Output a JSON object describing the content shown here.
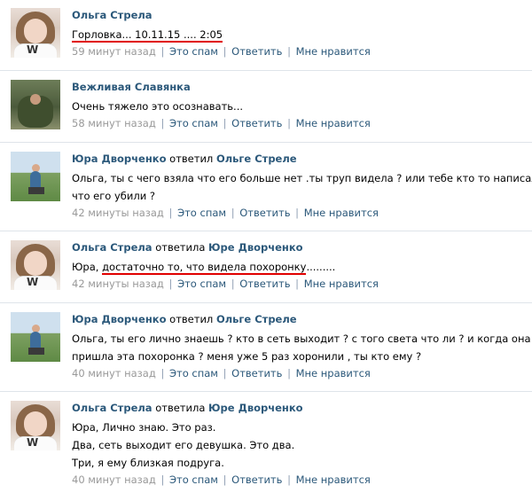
{
  "comments": [
    {
      "author": "Ольга Стрела",
      "verb": "",
      "reply_to": "",
      "lines": [
        "Горловка... 10.11.15 .... 2:05"
      ],
      "time": "59 минут назад",
      "actions": [
        "Это спам",
        "Ответить",
        "Мне нравится"
      ],
      "avatar": "girl-avatar"
    },
    {
      "author": "Вежливая Славянка",
      "verb": "",
      "reply_to": "",
      "lines": [
        "Очень тяжело это осознавать..."
      ],
      "time": "58 минут назад",
      "actions": [
        "Это спам",
        "Ответить",
        "Мне нравится"
      ],
      "avatar": "person-avatar"
    },
    {
      "author": "Юра Дворченко",
      "verb": "ответил",
      "reply_to": "Ольге Стреле",
      "lines": [
        "Ольга, ты с чего взяла что его больше нет .ты труп видела ? или тебе кто то написал",
        "что его убили ?"
      ],
      "time": "42 минуты назад",
      "actions": [
        "Это спам",
        "Ответить",
        "Мне нравится"
      ],
      "avatar": "field-avatar"
    },
    {
      "author": "Ольга Стрела",
      "verb": "ответила",
      "reply_to": "Юре Дворченко",
      "lines_prefix": "Юра, ",
      "lines_underlined": "достаточно то, что видела похоронку",
      "lines_suffix": ".........",
      "time": "42 минуты назад",
      "actions": [
        "Это спам",
        "Ответить",
        "Мне нравится"
      ],
      "avatar": "girl-avatar"
    },
    {
      "author": "Юра Дворченко",
      "verb": "ответил",
      "reply_to": "Ольге Стреле",
      "lines": [
        "Ольга, ты его лично знаешь ? кто в сеть выходит ? с того света что ли ? и когда она",
        "пришла эта похоронка ? меня уже 5 раз хоронили , ты кто ему ?"
      ],
      "time": "40 минут назад",
      "actions": [
        "Это спам",
        "Ответить",
        "Мне нравится"
      ],
      "avatar": "field-avatar"
    },
    {
      "author": "Ольга Стрела",
      "verb": "ответила",
      "reply_to": "Юре Дворченко",
      "lines": [
        "Юра, Лично знаю. Это раз.",
        "Два, сеть выходит его девушка. Это два.",
        "Три, я ему близкая подруга."
      ],
      "time": "40 минут назад",
      "actions": [
        "Это спам",
        "Ответить",
        "Мне нравится"
      ],
      "avatar": "girl-avatar"
    }
  ]
}
